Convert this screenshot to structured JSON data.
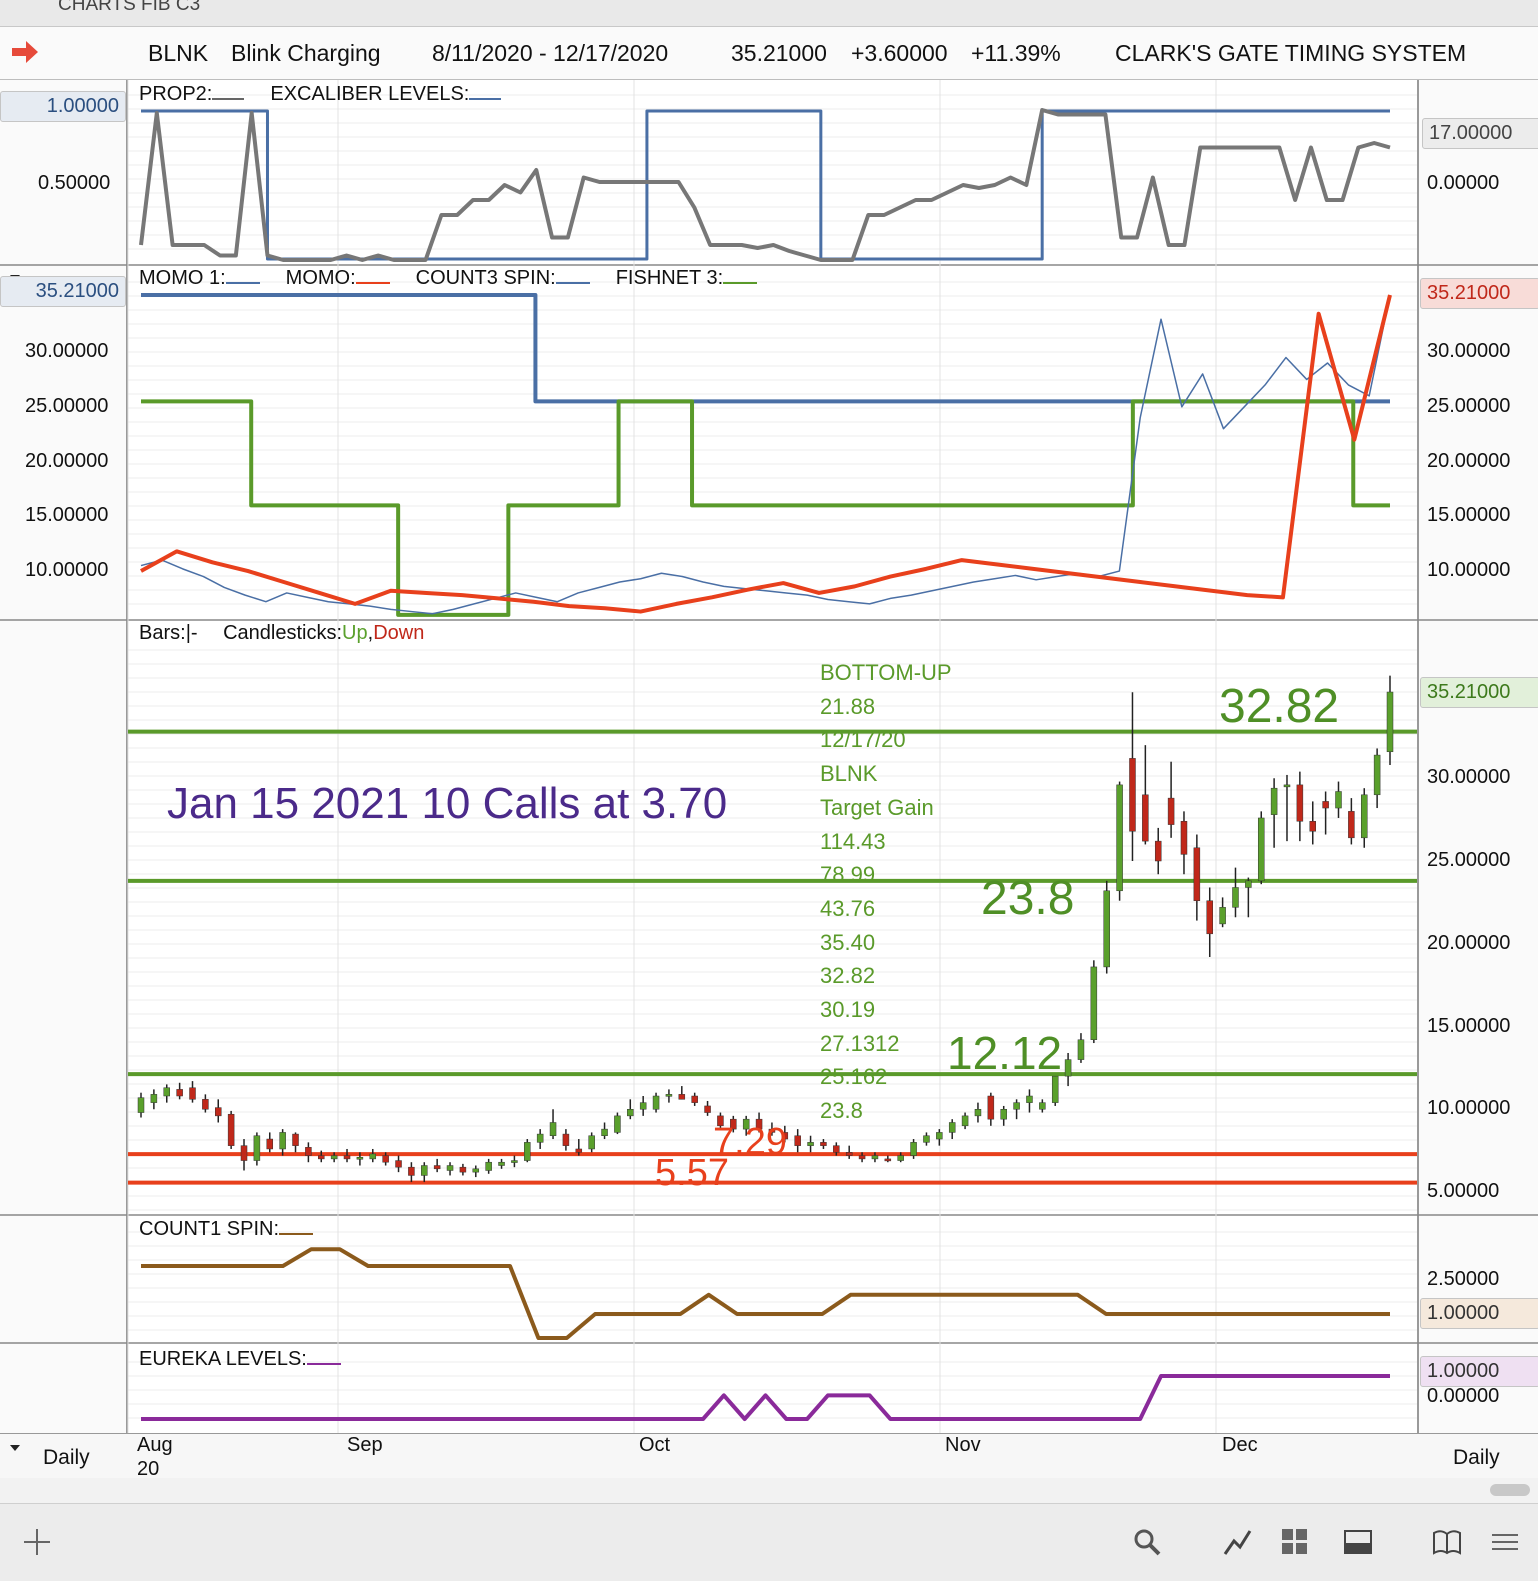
{
  "window": {
    "title": "CHARTS FIB C3"
  },
  "header": {
    "symbol": "BLNK",
    "company": "Blink Charging",
    "date_range": "8/11/2020 - 12/17/2020",
    "last": "35.21000",
    "change": "+3.60000",
    "pct_change": "+11.39%",
    "system": "CLARK'S GATE TIMING SYSTEM"
  },
  "panes": {
    "prop2": {
      "legend_a": "PROP2:",
      "legend_b": "EXCALIBER LEVELS:",
      "left_ticks": [
        "1.00000",
        "0.50000"
      ],
      "right_ticks": [
        "17.00000",
        "0.00000"
      ]
    },
    "momo": {
      "legend_a": "MOMO 1:",
      "legend_b": "MOMO:",
      "legend_c": "COUNT3 SPIN:",
      "legend_d": "FISHNET 3:",
      "left_current": "35.21000",
      "ticks": [
        "30.00000",
        "25.00000",
        "20.00000",
        "15.00000",
        "10.00000"
      ],
      "right_current": "35.21000"
    },
    "price": {
      "legend_bars": "Bars:",
      "legend_bars_sym": "|-",
      "legend_candles": "Candlesticks:",
      "legend_up": "Up",
      "legend_sep": ",",
      "legend_down": "Down",
      "current": "35.21000",
      "ticks": [
        "30.00000",
        "25.00000",
        "20.00000",
        "15.00000",
        "10.00000",
        "5.00000"
      ],
      "note": "Jan 15 2021 10 Calls at 3.70",
      "fib_list": [
        "BOTTOM-UP",
        "21.88",
        "12/17/20",
        "BLNK",
        "Target Gain",
        "114.43",
        "78.99",
        "43.76",
        "35.40",
        "32.82",
        "30.19",
        "27.1312",
        "25.162",
        "23.8"
      ],
      "level_labels": {
        "l1": "32.82",
        "l2": "23.8",
        "l3": "12.12",
        "l4": "7.29",
        "l5": "5.57"
      }
    },
    "count1": {
      "legend": "COUNT1 SPIN:",
      "ticks": [
        "2.50000",
        "1.00000"
      ]
    },
    "eureka": {
      "legend": "EUREKA LEVELS:",
      "ticks": [
        "1.00000",
        "0.00000"
      ]
    }
  },
  "xaxis": {
    "labels": [
      "Aug",
      "Sep",
      "Oct",
      "Nov",
      "Dec"
    ],
    "year": "20",
    "period": "Daily",
    "period_right": "Daily"
  },
  "toolbar": {
    "icons": [
      "plus-icon",
      "search-icon",
      "draw-line-icon",
      "grid-icon",
      "panel-icon",
      "book-icon",
      "menu-icon"
    ]
  },
  "colors": {
    "up": "#5aa02c",
    "down": "#c0281a",
    "momo": "#e8401c",
    "momo1": "#4a6fa5",
    "fishnet": "#5a9a2a",
    "count1": "#8b5a1c",
    "eureka": "#8a2a9a",
    "level_green": "#5a9a2a",
    "level_red": "#e8401c"
  },
  "chart_data": [
    {
      "type": "line",
      "title": "PROP2 / EXCALIBER LEVELS",
      "series": [
        {
          "name": "PROP2",
          "values": [
            0.1,
            0.98,
            0.1,
            0.1,
            0.1,
            0.03,
            0.03,
            0.98,
            0.03,
            0.0,
            0.0,
            0.0,
            0.0,
            0.03,
            0.0,
            0.03,
            0.0,
            0.0,
            0.0,
            0.3,
            0.3,
            0.4,
            0.4,
            0.5,
            0.45,
            0.6,
            0.15,
            0.15,
            0.55,
            0.52,
            0.52,
            0.52,
            0.52,
            0.52,
            0.52,
            0.35,
            0.1,
            0.1,
            0.1,
            0.08,
            0.1,
            0.06,
            0.03,
            0.0,
            0.0,
            0.0,
            0.3,
            0.3,
            0.35,
            0.4,
            0.4,
            0.45,
            0.5,
            0.48,
            0.5,
            0.55,
            0.5,
            1.0,
            0.97,
            0.97,
            0.97,
            0.97,
            0.15,
            0.15,
            0.55,
            0.1,
            0.1,
            0.75,
            0.75,
            0.75,
            0.75,
            0.75,
            0.75,
            0.4,
            0.75,
            0.4,
            0.4,
            0.75,
            0.78,
            0.75
          ]
        },
        {
          "name": "EXCALIBER LEVELS",
          "values": [
            1,
            1,
            1,
            1,
            1,
            1,
            1,
            1,
            0,
            0,
            0,
            0,
            0,
            0,
            0,
            0,
            0,
            0,
            0,
            0,
            0,
            0,
            0,
            0,
            0,
            0,
            0,
            0,
            0,
            0,
            0,
            0,
            1,
            1,
            1,
            1,
            1,
            1,
            1,
            1,
            1,
            1,
            1,
            0,
            0,
            0,
            0,
            0,
            0,
            0,
            0,
            0,
            0,
            0,
            0,
            0,
            0,
            1,
            1,
            1,
            1,
            1,
            1,
            1,
            1,
            1,
            1,
            1,
            1,
            1,
            1,
            1,
            1,
            1,
            1,
            1,
            1,
            1,
            1,
            1
          ]
        }
      ]
    },
    {
      "type": "line",
      "title": "MOMO",
      "ylim": [
        5,
        35.21
      ],
      "series": [
        {
          "name": "MOMO 1",
          "values": [
            10.5,
            11.0,
            10.2,
            9.5,
            8.5,
            7.8,
            7.2,
            8.0,
            7.6,
            7.2,
            7.0,
            6.8,
            6.5,
            6.3,
            6.1,
            6.5,
            7.0,
            7.5,
            8.0,
            7.6,
            7.2,
            8.0,
            8.5,
            9.0,
            9.3,
            9.8,
            9.5,
            9.0,
            8.6,
            8.4,
            8.2,
            8.0,
            7.8,
            7.4,
            7.2,
            7.0,
            7.5,
            7.8,
            8.2,
            8.6,
            9.0,
            9.3,
            9.6,
            9.2,
            9.5,
            9.8,
            9.5,
            10.0,
            24.0,
            33.0,
            25.0,
            28.0,
            23.0,
            25.0,
            27.0,
            29.5,
            27.5,
            29.0,
            27.0,
            26.0,
            35.21
          ]
        },
        {
          "name": "MOMO",
          "values": [
            10.0,
            11.8,
            10.8,
            10.0,
            9.0,
            8.0,
            7.0,
            8.2,
            8.0,
            7.8,
            7.5,
            7.2,
            6.8,
            6.6,
            6.3,
            7.0,
            7.6,
            8.3,
            8.9,
            8.0,
            8.6,
            9.5,
            10.2,
            11.0,
            10.6,
            10.2,
            9.8,
            9.4,
            9.0,
            8.6,
            8.2,
            7.8,
            7.6,
            33.5,
            22.0,
            35.21
          ]
        },
        {
          "name": "COUNT3 SPIN",
          "values": [
            35.21,
            35.21,
            35.21,
            35.21,
            35.21,
            35.21,
            25.5,
            25.5,
            25.5,
            25.5,
            25.5,
            25.5,
            25.5,
            25.5,
            25.5,
            25.5,
            25.5,
            25.5,
            25.5,
            25.5
          ]
        },
        {
          "name": "FISHNET 3",
          "values": [
            25.5,
            25.5,
            25.5,
            16.0,
            16.0,
            16.0,
            16.0,
            6.0,
            6.0,
            6.0,
            16.0,
            16.0,
            16.0,
            25.5,
            25.5,
            16.0,
            16.0,
            16.0,
            16.0,
            16.0,
            16.0,
            16.0,
            16.0,
            16.0,
            16.0,
            16.0,
            16.0,
            25.5,
            25.5,
            25.5,
            25.5,
            25.5,
            25.5,
            16.0,
            16.0
          ]
        }
      ]
    },
    {
      "type": "bar",
      "title": "BLNK Daily",
      "ylim": [
        3,
        36.5
      ],
      "x": [
        "Aug",
        "Sep",
        "Oct",
        "Nov",
        "Dec"
      ],
      "ohlc": [
        [
          9.8,
          11.0,
          9.5,
          10.7
        ],
        [
          10.4,
          11.2,
          10.0,
          10.9
        ],
        [
          10.8,
          11.5,
          10.4,
          11.3
        ],
        [
          11.2,
          11.6,
          10.6,
          10.8
        ],
        [
          11.3,
          11.7,
          10.4,
          10.6
        ],
        [
          10.6,
          10.9,
          9.8,
          10.0
        ],
        [
          10.1,
          10.6,
          9.2,
          9.6
        ],
        [
          9.7,
          9.9,
          7.6,
          7.8
        ],
        [
          7.8,
          8.2,
          6.3,
          6.9
        ],
        [
          6.9,
          8.6,
          6.6,
          8.4
        ],
        [
          8.2,
          8.6,
          7.4,
          7.6
        ],
        [
          7.6,
          8.8,
          7.2,
          8.6
        ],
        [
          8.5,
          8.6,
          7.4,
          7.8
        ],
        [
          7.7,
          8.0,
          6.8,
          7.2
        ],
        [
          7.2,
          7.5,
          6.8,
          7.0
        ],
        [
          7.0,
          7.4,
          6.8,
          7.2
        ],
        [
          7.2,
          7.6,
          6.8,
          7.0
        ],
        [
          7.0,
          7.4,
          6.6,
          7.1
        ],
        [
          7.0,
          7.6,
          6.8,
          7.3
        ],
        [
          7.2,
          7.4,
          6.6,
          6.8
        ],
        [
          6.9,
          7.2,
          6.2,
          6.5
        ],
        [
          6.5,
          6.8,
          5.6,
          6.0
        ],
        [
          6.0,
          6.8,
          5.6,
          6.6
        ],
        [
          6.6,
          7.0,
          6.2,
          6.4
        ],
        [
          6.3,
          6.8,
          6.0,
          6.6
        ],
        [
          6.5,
          6.7,
          6.0,
          6.2
        ],
        [
          6.2,
          6.6,
          5.9,
          6.4
        ],
        [
          6.3,
          7.0,
          6.1,
          6.8
        ],
        [
          6.6,
          7.0,
          6.4,
          6.8
        ],
        [
          6.8,
          7.2,
          6.5,
          6.9
        ],
        [
          6.9,
          8.2,
          6.8,
          8.0
        ],
        [
          8.0,
          8.8,
          7.6,
          8.5
        ],
        [
          8.4,
          10.0,
          8.2,
          9.2
        ],
        [
          8.5,
          8.8,
          7.5,
          7.8
        ],
        [
          7.6,
          8.2,
          7.2,
          7.4
        ],
        [
          7.6,
          8.6,
          7.4,
          8.4
        ],
        [
          8.4,
          9.2,
          8.2,
          8.8
        ],
        [
          8.6,
          9.8,
          8.5,
          9.6
        ],
        [
          9.6,
          10.6,
          9.4,
          10.0
        ],
        [
          10.0,
          10.8,
          9.6,
          10.4
        ],
        [
          10.0,
          11.0,
          9.8,
          10.8
        ],
        [
          10.8,
          11.2,
          10.4,
          10.9
        ],
        [
          10.9,
          11.4,
          10.6,
          10.6
        ],
        [
          10.8,
          11.0,
          10.2,
          10.4
        ],
        [
          10.2,
          10.5,
          9.6,
          9.8
        ],
        [
          9.6,
          9.8,
          8.8,
          9.0
        ],
        [
          9.4,
          9.6,
          8.6,
          8.8
        ],
        [
          8.8,
          9.6,
          8.4,
          9.4
        ],
        [
          9.4,
          9.8,
          8.6,
          8.8
        ],
        [
          8.8,
          9.2,
          8.4,
          8.6
        ],
        [
          8.6,
          9.0,
          8.0,
          8.2
        ],
        [
          8.4,
          8.8,
          7.4,
          7.8
        ],
        [
          7.8,
          8.4,
          7.4,
          8.0
        ],
        [
          8.0,
          8.2,
          7.6,
          7.8
        ],
        [
          7.8,
          8.0,
          7.2,
          7.4
        ],
        [
          7.4,
          7.8,
          7.0,
          7.2
        ],
        [
          7.2,
          7.4,
          6.8,
          7.0
        ],
        [
          7.0,
          7.4,
          6.8,
          7.2
        ],
        [
          7.0,
          7.2,
          6.8,
          6.9
        ],
        [
          6.9,
          7.4,
          6.8,
          7.2
        ],
        [
          7.2,
          8.2,
          7.0,
          8.0
        ],
        [
          8.0,
          8.6,
          7.8,
          8.4
        ],
        [
          8.2,
          8.8,
          7.8,
          8.6
        ],
        [
          8.6,
          9.4,
          8.2,
          9.2
        ],
        [
          9.0,
          9.8,
          8.8,
          9.6
        ],
        [
          9.6,
          10.4,
          9.2,
          10.0
        ],
        [
          10.8,
          11.0,
          9.0,
          9.4
        ],
        [
          9.4,
          10.2,
          9.0,
          10.0
        ],
        [
          10.0,
          10.6,
          9.4,
          10.4
        ],
        [
          10.4,
          11.2,
          9.8,
          10.8
        ],
        [
          10.0,
          10.6,
          9.8,
          10.4
        ],
        [
          10.4,
          12.0,
          10.2,
          12.0
        ],
        [
          12.0,
          13.4,
          11.4,
          13.0
        ],
        [
          13.0,
          14.6,
          12.8,
          14.2
        ],
        [
          14.2,
          19.0,
          14.0,
          18.6
        ],
        [
          18.6,
          23.8,
          18.2,
          23.2
        ],
        [
          23.2,
          29.8,
          22.6,
          29.6
        ],
        [
          31.2,
          35.2,
          25.0,
          26.8
        ],
        [
          29.0,
          32.0,
          26.0,
          26.2
        ],
        [
          26.2,
          27.0,
          24.2,
          25.0
        ],
        [
          28.8,
          31.0,
          26.4,
          27.2
        ],
        [
          27.4,
          28.0,
          24.2,
          25.4
        ],
        [
          25.8,
          26.6,
          21.4,
          22.6
        ],
        [
          22.6,
          23.4,
          19.2,
          20.6
        ],
        [
          21.2,
          22.8,
          21.0,
          22.2
        ],
        [
          22.2,
          24.6,
          21.6,
          23.4
        ],
        [
          23.4,
          24.0,
          21.6,
          23.8
        ],
        [
          23.8,
          28.0,
          23.6,
          27.6
        ],
        [
          27.8,
          30.0,
          25.8,
          29.4
        ],
        [
          29.6,
          30.2,
          26.2,
          29.6
        ],
        [
          29.6,
          30.4,
          26.2,
          27.4
        ],
        [
          27.4,
          28.6,
          26.0,
          26.8
        ],
        [
          28.6,
          29.2,
          26.6,
          28.2
        ],
        [
          28.2,
          29.8,
          27.6,
          29.2
        ],
        [
          28.0,
          28.8,
          26.0,
          26.4
        ],
        [
          26.4,
          29.4,
          25.8,
          29.0
        ],
        [
          29.0,
          31.8,
          28.2,
          31.4
        ],
        [
          31.6,
          36.2,
          30.8,
          35.21
        ]
      ],
      "levels": {
        "green": [
          32.82,
          23.8,
          12.12
        ],
        "red": [
          7.29,
          5.57
        ]
      }
    },
    {
      "type": "line",
      "title": "COUNT1 SPIN",
      "series": [
        {
          "name": "COUNT1 SPIN",
          "values": [
            3.0,
            3.0,
            3.0,
            3.0,
            3.0,
            3.0,
            3.7,
            3.7,
            3.0,
            3.0,
            3.0,
            3.0,
            3.0,
            3.0,
            0.0,
            0.0,
            1.0,
            1.0,
            1.0,
            1.0,
            1.8,
            1.0,
            1.0,
            1.0,
            1.0,
            1.8,
            1.8,
            1.8,
            1.8,
            1.8,
            1.8,
            1.8,
            1.8,
            1.8,
            1.0,
            1.0,
            1.0,
            1.0,
            1.0,
            1.0,
            1.0,
            1.0,
            1.0,
            1.0,
            1.0
          ]
        }
      ]
    },
    {
      "type": "line",
      "title": "EUREKA LEVELS",
      "series": [
        {
          "name": "EUREKA LEVELS",
          "values": [
            0,
            0,
            0,
            0,
            0,
            0,
            0,
            0,
            0,
            0,
            0,
            0,
            0,
            0,
            0,
            0,
            0,
            0,
            0,
            0,
            0,
            0,
            0,
            0,
            0,
            0,
            0,
            0,
            0.55,
            0,
            0.55,
            0,
            0,
            0.55,
            0.55,
            0.55,
            0,
            0,
            0,
            0,
            0,
            0,
            0,
            0,
            0,
            0,
            0,
            0,
            0,
            1,
            1,
            1,
            1,
            1,
            1,
            1,
            1,
            1,
            1,
            1,
            1
          ]
        }
      ]
    }
  ]
}
